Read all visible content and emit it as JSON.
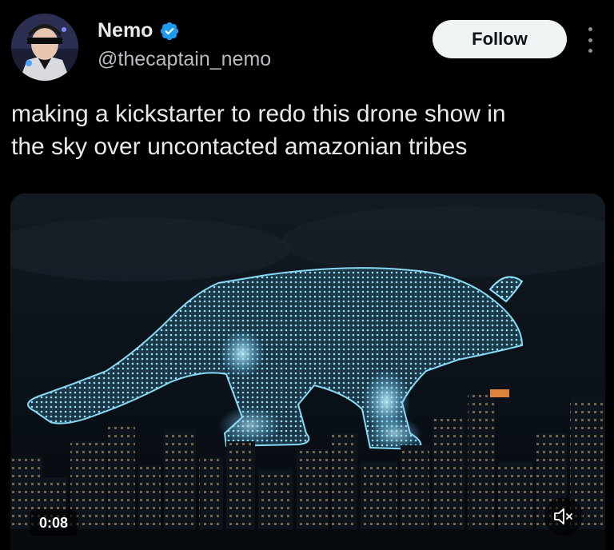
{
  "author": {
    "display_name": "Nemo",
    "handle": "@thecaptain_nemo",
    "verified_icon": "verified-badge-icon",
    "avatar_icon": "profile-avatar"
  },
  "actions": {
    "follow_label": "Follow",
    "more_icon": "more-options-icon"
  },
  "tweet": {
    "text_line1": "making a kickstarter to redo this drone show in",
    "text_line2": "the sky over uncontacted amazonian tribes"
  },
  "video": {
    "duration": "0:08",
    "mute_icon": "volume-muted-icon"
  },
  "colors": {
    "background": "#000000",
    "text": "#e7e9ea",
    "handle": "#b7bcc1",
    "verified": "#1d9bf0",
    "follow_bg": "#eff3f4",
    "drone_glow": "#8fe3ff"
  }
}
